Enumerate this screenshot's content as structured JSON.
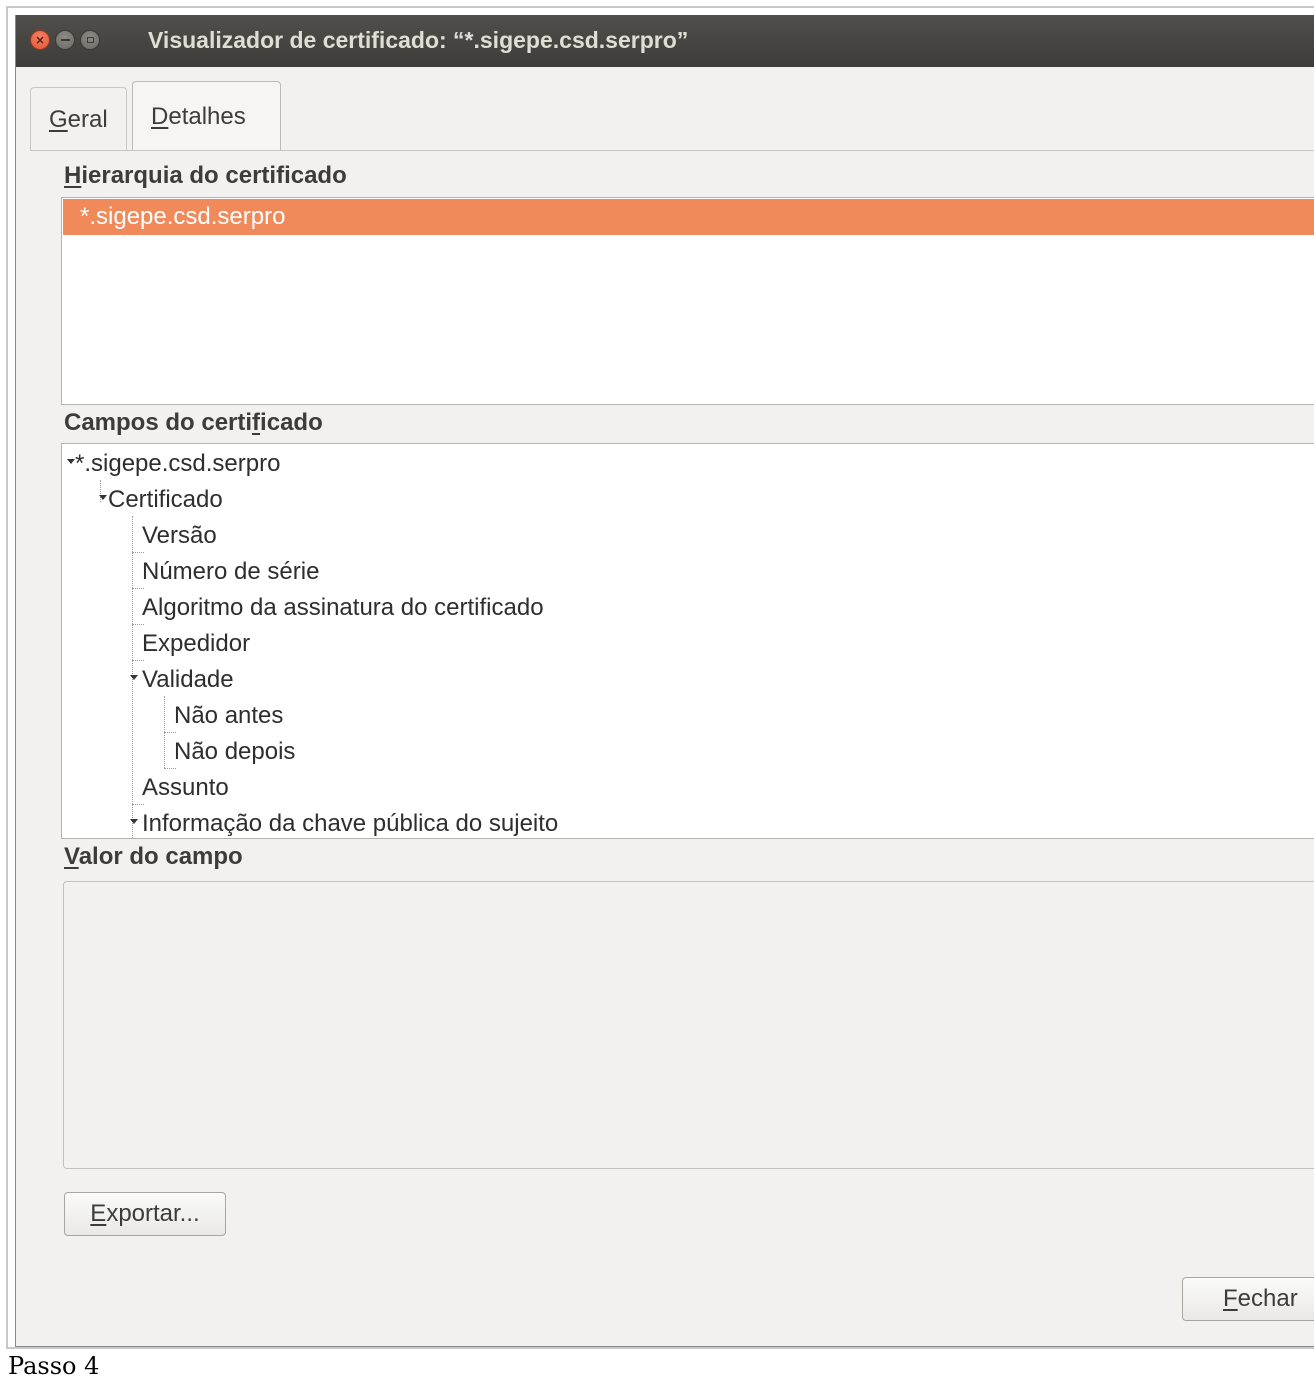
{
  "window": {
    "title": "Visualizador de certificado: “*.sigepe.csd.serpro”"
  },
  "tabs": [
    {
      "label_first": "G",
      "label_rest": "eral",
      "selected": false
    },
    {
      "label_first": "D",
      "label_rest": "etalhes",
      "selected": true
    }
  ],
  "hierarchy": {
    "label_first": "H",
    "label_rest": "ierarquia do certificado",
    "items": [
      "*.sigepe.csd.serpro"
    ]
  },
  "fields": {
    "label_pre": "Campos do certi",
    "label_mnemonic": "f",
    "label_post": "icado",
    "tree": [
      {
        "text": "*.sigepe.csd.serpro",
        "level": 0,
        "expanded": true
      },
      {
        "text": "Certificado",
        "level": 1,
        "expanded": true
      },
      {
        "text": "Versão",
        "level": 2
      },
      {
        "text": "Número de série",
        "level": 2
      },
      {
        "text": "Algoritmo da assinatura do certificado",
        "level": 2
      },
      {
        "text": "Expedidor",
        "level": 2
      },
      {
        "text": "Validade",
        "level": 2,
        "expanded": true
      },
      {
        "text": "Não antes",
        "level": 3
      },
      {
        "text": "Não depois",
        "level": 3
      },
      {
        "text": "Assunto",
        "level": 2
      },
      {
        "text": "Informação da chave pública do sujeito",
        "level": 2,
        "expanded": true
      }
    ]
  },
  "value": {
    "label_first": "V",
    "label_rest": "alor do campo",
    "content": ""
  },
  "buttons": {
    "export_first": "E",
    "export_rest": "xportar...",
    "close_first": "F",
    "close_rest": "echar"
  },
  "caption": "Passo 4",
  "colors": {
    "selection": "#f08a5a",
    "titlebar": "#3d3c38",
    "close_button": "#e0552f"
  }
}
